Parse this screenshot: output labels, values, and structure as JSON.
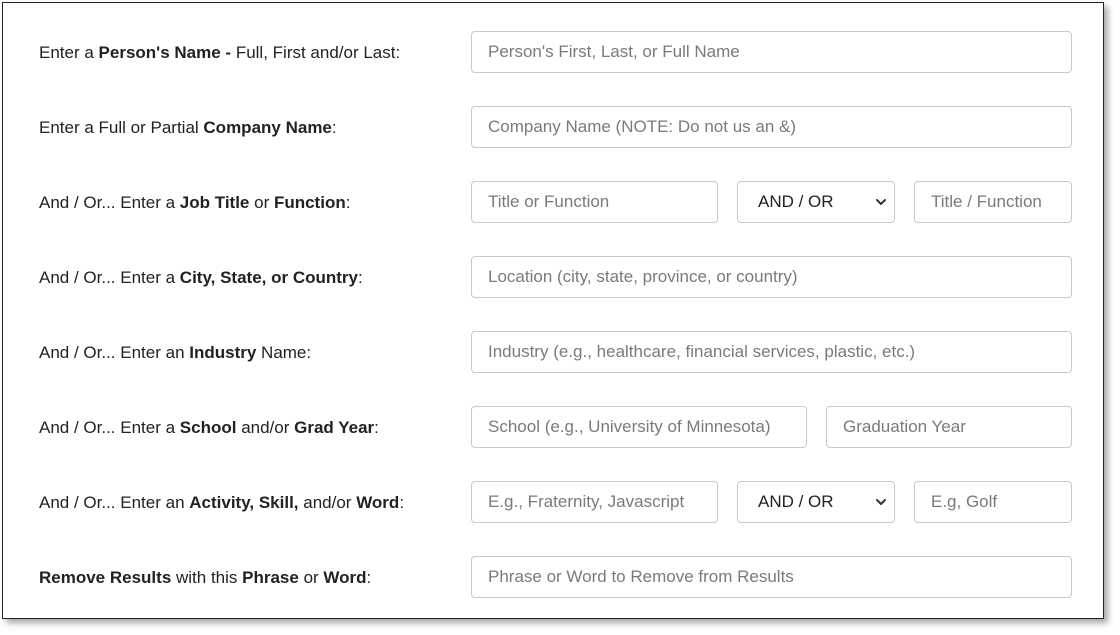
{
  "rows": [
    {
      "label": [
        {
          "t": "Enter a ",
          "b": false
        },
        {
          "t": "Person's Name -",
          "b": true
        },
        {
          "t": " Full, First and/or Last:",
          "b": false
        }
      ],
      "placeholder": "Person's First, Last, or Full Name"
    },
    {
      "label": [
        {
          "t": "Enter a Full or Partial ",
          "b": false
        },
        {
          "t": "Company Name",
          "b": true
        },
        {
          "t": ":",
          "b": false
        }
      ],
      "placeholder": "Company Name (NOTE: Do not us an &)"
    },
    {
      "label": [
        {
          "t": "And / Or... Enter a ",
          "b": false
        },
        {
          "t": "Job Title",
          "b": true
        },
        {
          "t": " or ",
          "b": false
        },
        {
          "t": "Function",
          "b": true
        },
        {
          "t": ":",
          "b": false
        }
      ],
      "placeholder": "Title or Function",
      "operator": "AND / OR",
      "placeholder2": "Title / Function"
    },
    {
      "label": [
        {
          "t": "And / Or... Enter a ",
          "b": false
        },
        {
          "t": "City, State, or Country",
          "b": true
        },
        {
          "t": ":",
          "b": false
        }
      ],
      "placeholder": "Location (city, state, province, or country)"
    },
    {
      "label": [
        {
          "t": "And / Or... Enter an ",
          "b": false
        },
        {
          "t": "Industry",
          "b": true
        },
        {
          "t": " Name:",
          "b": false
        }
      ],
      "placeholder": "Industry (e.g., healthcare, financial services, plastic, etc.)"
    },
    {
      "label": [
        {
          "t": "And / Or... Enter a ",
          "b": false
        },
        {
          "t": "School",
          "b": true
        },
        {
          "t": " and/or ",
          "b": false
        },
        {
          "t": "Grad Year",
          "b": true
        },
        {
          "t": ":",
          "b": false
        }
      ],
      "placeholder": "School (e.g., University of Minnesota)",
      "placeholder2": "Graduation Year"
    },
    {
      "label": [
        {
          "t": "And / Or... Enter an ",
          "b": false
        },
        {
          "t": "Activity, Skill,",
          "b": true
        },
        {
          "t": " and/or ",
          "b": false
        },
        {
          "t": "Word",
          "b": true
        },
        {
          "t": ":",
          "b": false
        }
      ],
      "placeholder": "E.g., Fraternity, Javascript",
      "operator": "AND / OR",
      "placeholder2": "E.g, Golf"
    },
    {
      "label": [
        {
          "t": "Remove Results",
          "b": true
        },
        {
          "t": " with this ",
          "b": false
        },
        {
          "t": "Phrase",
          "b": true
        },
        {
          "t": " or ",
          "b": false
        },
        {
          "t": "Word",
          "b": true
        },
        {
          "t": ":",
          "b": false
        }
      ],
      "placeholder": "Phrase or Word to Remove from Results"
    }
  ],
  "icons": {
    "select_arrow": "chevron-down-icon"
  }
}
